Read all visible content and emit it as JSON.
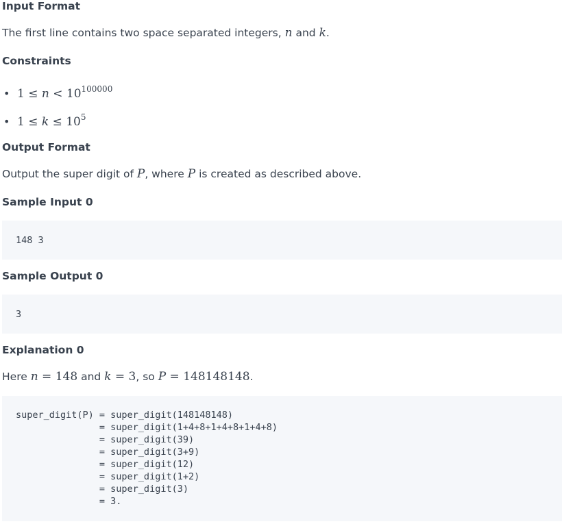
{
  "input_format": {
    "heading": "Input Format",
    "text_before": "The first line contains two space separated integers, ",
    "var_n": "n",
    "text_and": " and ",
    "var_k": "k",
    "text_end": "."
  },
  "constraints": {
    "heading": "Constraints",
    "items": [
      {
        "bullet": "•",
        "expr": "1 ≤ ",
        "var": "n",
        "rel": " < 10",
        "exp": "100000"
      },
      {
        "bullet": "•",
        "expr": "1 ≤ ",
        "var": "k",
        "rel": " ≤ 10",
        "exp": "5"
      }
    ]
  },
  "output_format": {
    "heading": "Output Format",
    "text_before": "Output the super digit of ",
    "var_p1": "P",
    "text_middle": ", where ",
    "var_p2": "P",
    "text_end": " is created as described above."
  },
  "sample_input": {
    "heading": "Sample Input 0",
    "code": "148 3"
  },
  "sample_output": {
    "heading": "Sample Output 0",
    "code": "3"
  },
  "explanation": {
    "heading": "Explanation 0",
    "text_here": "Here ",
    "var_n": "n",
    "eq_n": " = 148",
    "text_and": " and ",
    "var_k": "k",
    "eq_k": " = 3",
    "text_so": ", so ",
    "var_p": "P",
    "eq_p": " = 148148148",
    "text_end": ".",
    "code": "super_digit(P) = super_digit(148148148)\n               = super_digit(1+4+8+1+4+8+1+4+8)\n               = super_digit(39)\n               = super_digit(3+9)\n               = super_digit(12)\n               = super_digit(1+2)\n               = super_digit(3)\n               = 3."
  }
}
